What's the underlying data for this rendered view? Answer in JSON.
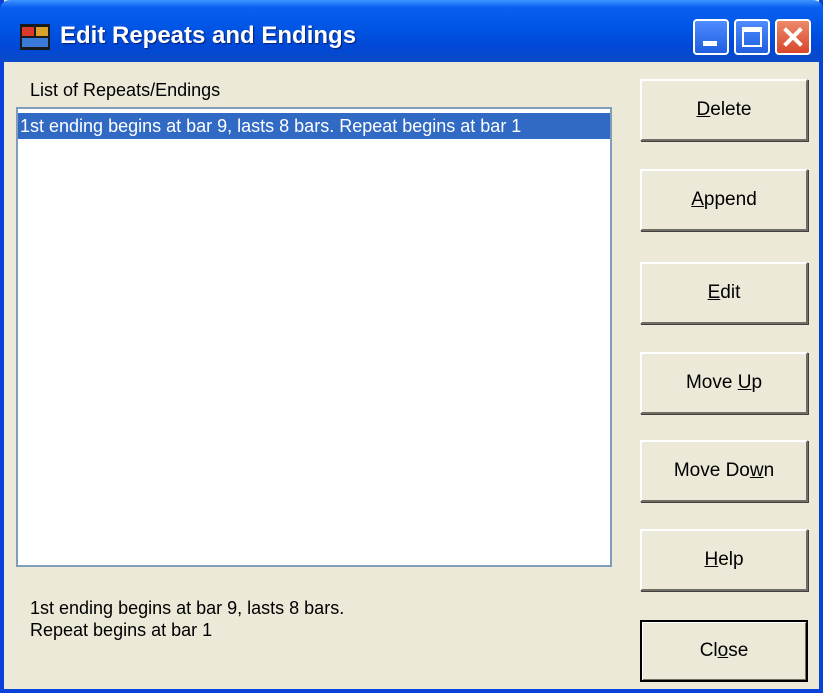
{
  "window": {
    "title": "Edit Repeats and Endings"
  },
  "list": {
    "label": "List of Repeats/Endings",
    "items": [
      "1st ending begins at bar 9, lasts 8 bars. Repeat begins at bar 1"
    ]
  },
  "description": "1st ending begins at bar 9, lasts 8 bars.\nRepeat begins at bar 1",
  "buttons": {
    "delete": {
      "label": "Delete",
      "mnemonic_index": 0
    },
    "append": {
      "label": "Append",
      "mnemonic_index": 0
    },
    "edit": {
      "label": "Edit",
      "mnemonic_index": 0
    },
    "move_up": {
      "label": "Move Up",
      "mnemonic_index": 5
    },
    "move_down": {
      "label": "Move Down",
      "mnemonic_index": 7
    },
    "help": {
      "label": "Help",
      "mnemonic_index": 0
    },
    "close": {
      "label": "Close",
      "mnemonic_index": 2
    }
  },
  "colors": {
    "selection": "#316ac5",
    "title_bar": "#0055e5",
    "face": "#ece9d8"
  },
  "icons": [
    "app-icon",
    "minimize-icon",
    "maximize-icon",
    "close-icon"
  ]
}
